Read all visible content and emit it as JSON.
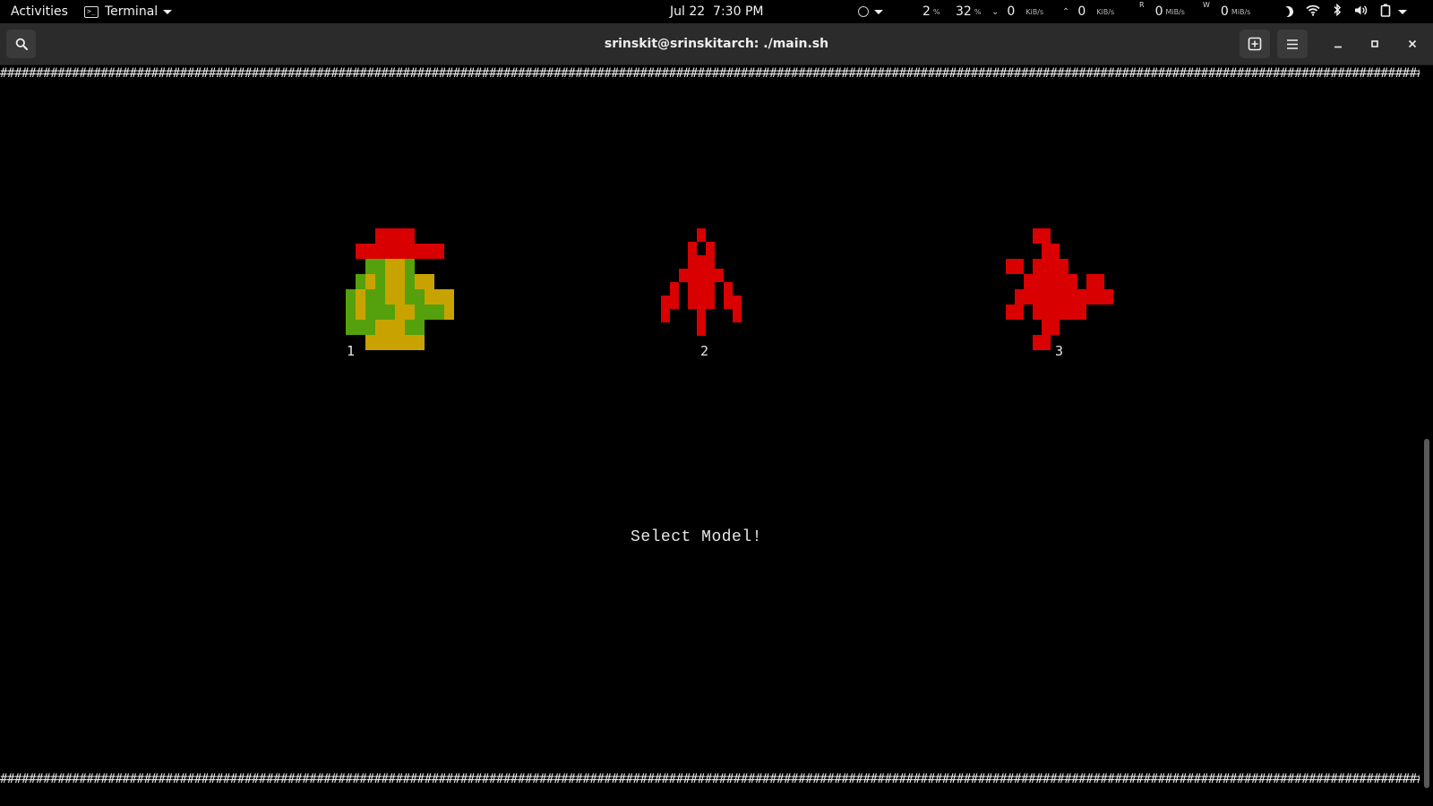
{
  "topbar": {
    "activities": "Activities",
    "app_name": "Terminal",
    "clock": "Jul 22  7:30 PM",
    "cpu_value": "2",
    "cpu_unit": "%",
    "mem_value": "32",
    "mem_unit": "%",
    "net_down_value": "0",
    "net_down_unit": "KiB/s",
    "net_up_value": "0",
    "net_up_unit": "KiB/s",
    "disk_read_label": "R",
    "disk_read_value": "0",
    "disk_read_unit": "MiB/s",
    "disk_write_label": "W",
    "disk_write_value": "0",
    "disk_write_unit": "MiB/s"
  },
  "window": {
    "title": "srinskit@srinskitarch: ./main.sh"
  },
  "terminal": {
    "prompt": "Select Model!",
    "sprites": [
      {
        "label": "1",
        "pixel_art": [
          "...rrrr...",
          ".rrrrrrrrr",
          "..ggyyg...",
          ".gygyygyy.",
          "gyggyyggyyy",
          "gygggyygggy",
          "gggyyygg..",
          "..yyyyyy.."
        ]
      },
      {
        "label": "2",
        "pixel_art": [
          "....r....",
          "...r.r...",
          "...rrr...",
          "..rrrrr..",
          ".r.rrr.r.",
          "rr.rrr.rr",
          "r...r...r",
          "....r...."
        ]
      },
      {
        "label": "3",
        "pixel_art": [
          "...rr.......",
          "....rr......",
          "rr.rrrr.....",
          "..rrrrrr.rr.",
          ".rrrrrrrrrrr",
          "rr.rrrrrr...",
          "....rr......",
          "...rr......."
        ]
      }
    ]
  },
  "colors": {
    "red": "#d80000",
    "green": "#54a10d",
    "yellow": "#c8a300",
    "terminal_bg": "#000000",
    "header_bg": "#2b2b2b"
  }
}
